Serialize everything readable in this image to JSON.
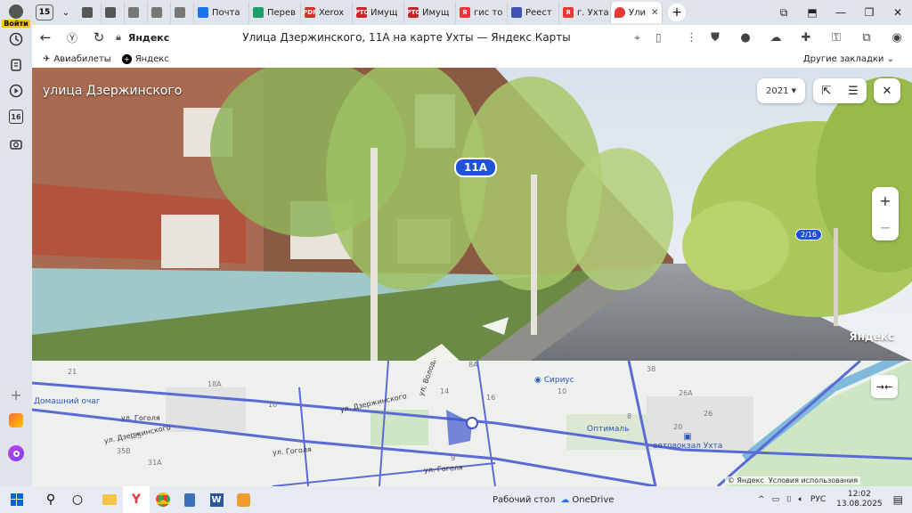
{
  "sidebar": {
    "login_label": "Войти",
    "tools": [
      "history-icon",
      "collections-icon",
      "video-icon",
      "calendar-icon",
      "screenshot-icon"
    ],
    "calendar_day": "16"
  },
  "tabs": {
    "count": "15",
    "items": [
      {
        "label": "",
        "fav_color": "#555555",
        "fav_text": ""
      },
      {
        "label": "",
        "fav_color": "#555555",
        "fav_text": ""
      },
      {
        "label": "",
        "fav_color": "#777777",
        "fav_text": ""
      },
      {
        "label": "",
        "fav_color": "#777777",
        "fav_text": ""
      },
      {
        "label": "",
        "fav_color": "#777777",
        "fav_text": ""
      },
      {
        "label": "Почта",
        "fav_color": "#1a73e8",
        "fav_text": ""
      },
      {
        "label": "Перев",
        "fav_color": "#1e9e6a",
        "fav_text": ""
      },
      {
        "label": "Xerox",
        "fav_color": "#d93025",
        "fav_text": "PDF"
      },
      {
        "label": "Имущ",
        "fav_color": "#c62828",
        "fav_text": "РТС"
      },
      {
        "label": "Имущ",
        "fav_color": "#c62828",
        "fav_text": "РТС"
      },
      {
        "label": "гис то",
        "fav_color": "#e53935",
        "fav_text": "Я"
      },
      {
        "label": "Реест",
        "fav_color": "#3f51b5",
        "fav_text": ""
      },
      {
        "label": "г. Ухта",
        "fav_color": "#e53935",
        "fav_text": "Я"
      }
    ],
    "active": {
      "label": "Ули",
      "fav_color": "#e53935"
    }
  },
  "addressbar": {
    "domain": "Яндекс",
    "title": "Улица Дзержинского, 11А на карте Ухты — Яндекс Карты"
  },
  "bookmarks": {
    "items": [
      "Авиабилеты",
      "Яндекс"
    ],
    "other": "Другие закладки"
  },
  "panorama": {
    "street": "улица Дзержинского",
    "year": "2021",
    "address_tag": "11А",
    "address_tag_small": "2/16",
    "watermark": "Яндекс",
    "zoom_in": "+",
    "zoom_out": "−"
  },
  "map": {
    "streets": [
      "ул. Дзержинского",
      "ул. Дзержинского",
      "ул. Гоголя",
      "ул. Гоголя",
      "ул. Гоголя",
      "ул. Володарского"
    ],
    "house_numbers": [
      "21",
      "18А",
      "14",
      "8А",
      "16",
      "10",
      "35",
      "35В",
      "31А",
      "38",
      "8",
      "26А",
      "26",
      "20",
      "10",
      "9"
    ],
    "pois": [
      "Сириус",
      "Домашний очаг",
      "Оптималь",
      "автовокзал Ухта"
    ],
    "copyright": "© Яндекс",
    "terms": "Условия использования"
  },
  "taskbar": {
    "desktop_label": "Рабочий стол",
    "onedrive_label": "OneDrive",
    "lang": "РУС",
    "time": "12:02",
    "date": "13.08.2025"
  },
  "colors": {
    "accent_blue": "#1f52d6",
    "yandex_yellow": "#f7c300",
    "route_blue": "#5b6bd6"
  }
}
